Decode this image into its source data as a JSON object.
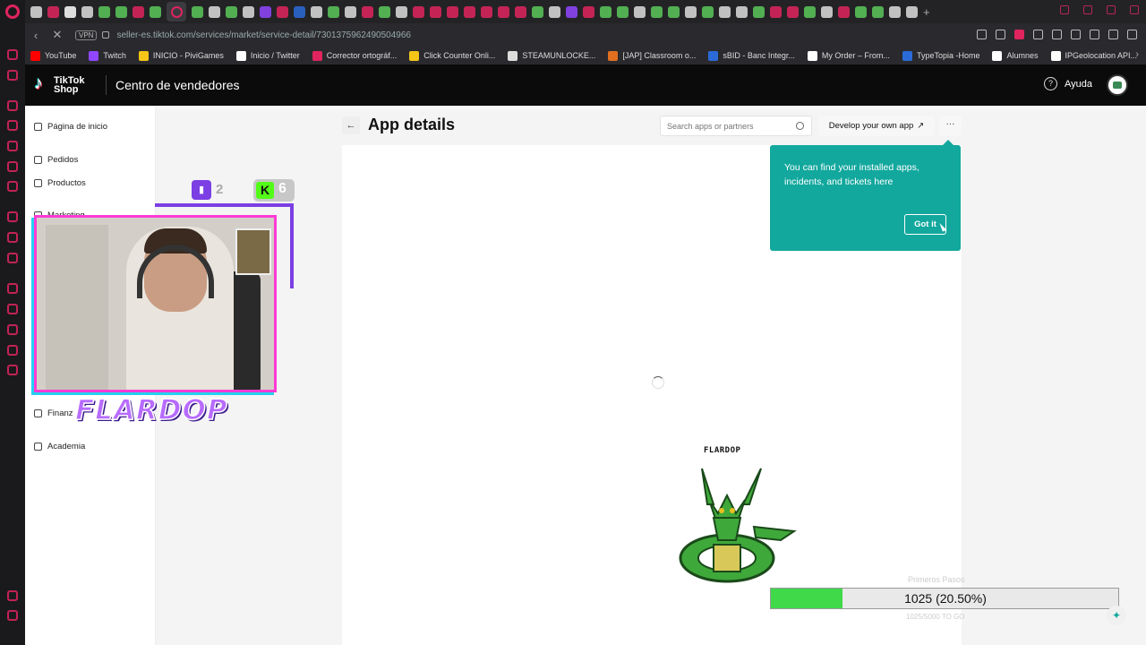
{
  "browser": {
    "url": "seller-es.tiktok.com/services/market/service-detail/7301375962490504966",
    "vpn_label": "VPN",
    "bookmarks": [
      {
        "label": "YouTube",
        "color": "#ff0000"
      },
      {
        "label": "Twitch",
        "color": "#9146ff"
      },
      {
        "label": "INICIO - PiviGames",
        "color": "#f5c518"
      },
      {
        "label": "Inicio / Twitter",
        "color": "#ffffff"
      },
      {
        "label": "Corrector ortográf...",
        "color": "#e0245e"
      },
      {
        "label": "Click Counter Onli...",
        "color": "#f5c518"
      },
      {
        "label": "STEAMUNLOCKE...",
        "color": "#dddddd"
      },
      {
        "label": "[JAP] Classroom o...",
        "color": "#e07020"
      },
      {
        "label": "sBID - Banc Integr...",
        "color": "#2a6bd8"
      },
      {
        "label": "My Order – From...",
        "color": "#ffffff"
      },
      {
        "label": "TypeTopia -Home",
        "color": "#2a6bd8"
      },
      {
        "label": "Alumnes",
        "color": "#ffffff"
      },
      {
        "label": "IPGeolocation API...",
        "color": "#ffffff"
      }
    ]
  },
  "header": {
    "brand_line1": "TikTok",
    "brand_line2": "Shop",
    "title": "Centro de vendedores",
    "help_label": "Ayuda"
  },
  "sidebar": {
    "items": [
      {
        "label": "Página de inicio"
      },
      {
        "label": "Pedidos"
      },
      {
        "label": "Productos"
      },
      {
        "label": "Marketing"
      },
      {
        "label": "Finanz"
      },
      {
        "label": "Academia"
      }
    ]
  },
  "main": {
    "title": "App details",
    "search_placeholder": "Search apps or partners",
    "develop_label": "Develop your own app",
    "more_label": "···"
  },
  "tooltip": {
    "text": "You can find your installed apps, incidents, and tickets here",
    "button": "Got it"
  },
  "overlay": {
    "twitch_count": "2",
    "kick_count": "6",
    "streamer_name": "FLARDOP",
    "pokemon_label": "FLARDOP",
    "progress_label": "1025 (20.50%)",
    "progress_fraction": 0.205,
    "faint_top": "Primeros Pasos",
    "faint_bottom": "1025/5000 TO GO"
  },
  "colors": {
    "tooltip_bg": "#13a89e",
    "progress_fill": "#3fd94a",
    "twitch": "#7b3fe4",
    "kick": "#53fc18"
  }
}
